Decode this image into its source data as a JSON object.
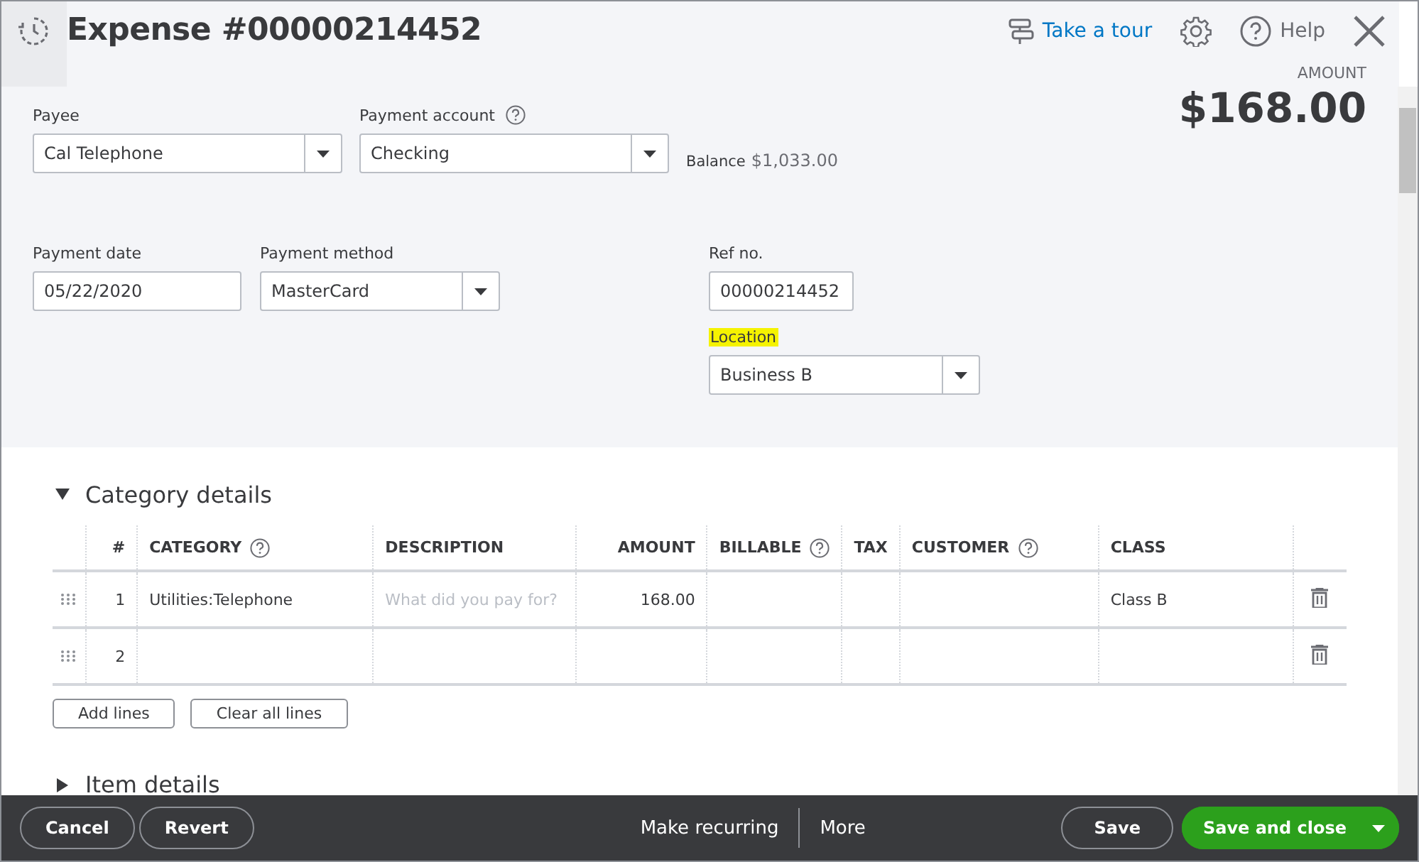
{
  "header": {
    "title": "Expense #00000214452",
    "tour_link": "Take a tour",
    "help": "Help"
  },
  "form": {
    "payee": {
      "label": "Payee",
      "value": "Cal Telephone",
      "kind": "select"
    },
    "payment_account": {
      "label": "Payment account",
      "value": "Checking",
      "kind": "select",
      "help": true
    },
    "balance": {
      "label": "Balance",
      "value": "$1,033.00"
    },
    "amount": {
      "label": "AMOUNT",
      "value": "$168.00"
    },
    "payment_date": {
      "label": "Payment date",
      "value": "05/22/2020",
      "kind": "text"
    },
    "payment_method": {
      "label": "Payment method",
      "value": "MasterCard",
      "kind": "select"
    },
    "ref_no": {
      "label": "Ref no.",
      "value": "00000214452",
      "kind": "text"
    },
    "location": {
      "label": "Location",
      "value": "Business B",
      "kind": "select",
      "highlighted": true
    }
  },
  "category_details": {
    "title": "Category details",
    "expanded": true,
    "columns": [
      {
        "label": "#",
        "help": false
      },
      {
        "label": "CATEGORY",
        "help": true
      },
      {
        "label": "DESCRIPTION",
        "help": false
      },
      {
        "label": "AMOUNT",
        "help": false
      },
      {
        "label": "BILLABLE",
        "help": true
      },
      {
        "label": "TAX",
        "help": false
      },
      {
        "label": "CUSTOMER",
        "help": true
      },
      {
        "label": "CLASS",
        "help": false
      }
    ],
    "rows": [
      {
        "number": "1",
        "category": "Utilities:Telephone",
        "description_placeholder": "What did you pay for?",
        "amount": "168.00",
        "class": "Class B"
      },
      {
        "number": "2"
      }
    ],
    "buttons": [
      "Add lines",
      "Clear all lines"
    ]
  },
  "item_details": {
    "title": "Item details",
    "expanded": false
  },
  "footer": {
    "left_buttons": [
      "Cancel",
      "Revert"
    ],
    "center_links": [
      "Make recurring",
      "More"
    ],
    "save": "Save",
    "save_and_close": "Save and close"
  }
}
